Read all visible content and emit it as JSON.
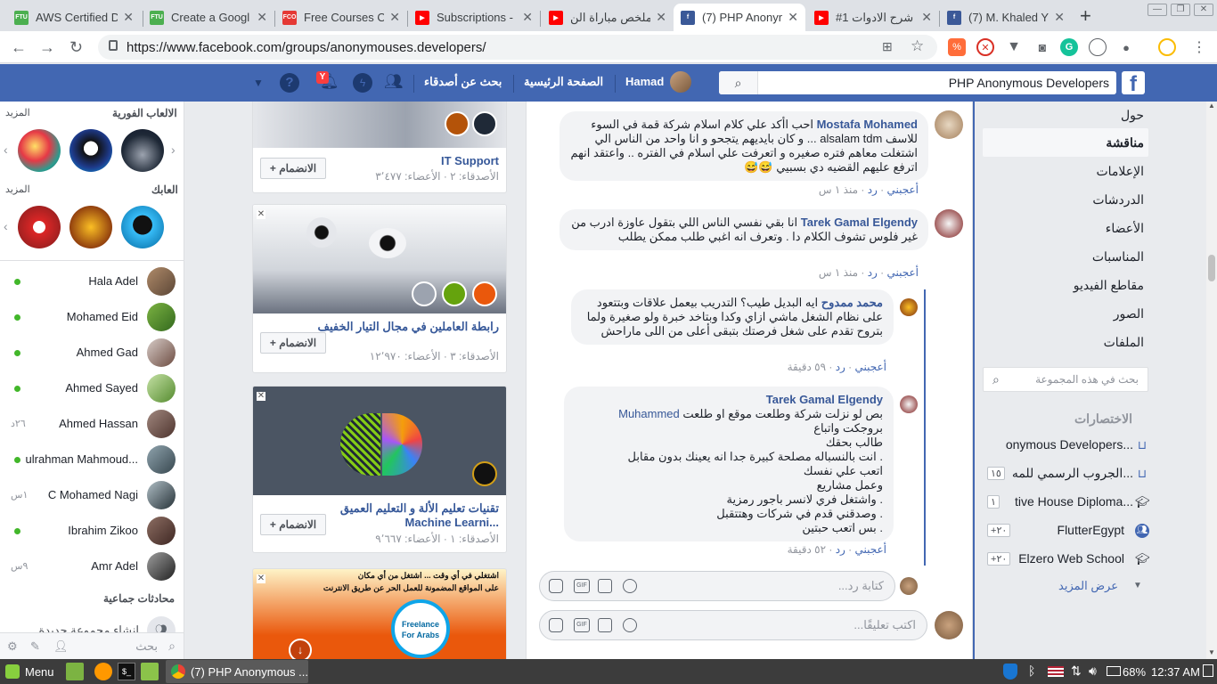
{
  "browser": {
    "tabs": [
      {
        "label": "AWS Certified D",
        "favicon": "ftu-icon",
        "color": "#4caf50"
      },
      {
        "label": "Create a Googl",
        "favicon": "ftu-icon",
        "color": "#4caf50"
      },
      {
        "label": "Free Courses O",
        "favicon": "fco-icon",
        "color": "#e53935"
      },
      {
        "label": "Subscriptions -",
        "favicon": "youtube-icon",
        "color": "#ff0000"
      },
      {
        "label": "ملخص مباراة الن",
        "favicon": "youtube-icon",
        "color": "#ff0000"
      },
      {
        "label": "(7) PHP Anonym",
        "favicon": "facebook-icon",
        "color": "#3b5998"
      },
      {
        "label": "#1 شرح الادوات",
        "favicon": "youtube-icon",
        "color": "#ff0000"
      },
      {
        "label": "(7) M. Khaled Y",
        "favicon": "facebook-icon",
        "color": "#3b5998"
      }
    ],
    "active_tab": 5,
    "url": "https://www.facebook.com/groups/anonymouses.developers/"
  },
  "fb_header": {
    "search_value": "PHP Anonymous Developers",
    "user_name": "Hamad",
    "home_label": "الصفحة الرئيسية",
    "find_friends_label": "بحث عن أصدقاء",
    "notif_count": "Y",
    "brand_color": "#4267b2"
  },
  "sidebar": {
    "instant_games_label": "الالعاب الفورية",
    "games_more": "المزيد",
    "playing_label": "العابك",
    "playing_more": "المزيد",
    "contacts": [
      {
        "name": "Hala Adel",
        "online": true,
        "time": ""
      },
      {
        "name": "Mohamed Eid",
        "online": true,
        "time": ""
      },
      {
        "name": "Ahmed Gad",
        "online": true,
        "time": ""
      },
      {
        "name": "Ahmed Sayed",
        "online": true,
        "time": ""
      },
      {
        "name": "Ahmed Hassan",
        "online": false,
        "time": "٢٦د"
      },
      {
        "name": "ulrahman Mahmoud...",
        "online": true,
        "time": ""
      },
      {
        "name": "C Mohamed Nagi",
        "online": false,
        "time": "١س"
      },
      {
        "name": "Ibrahim Zikoo",
        "online": true,
        "time": ""
      },
      {
        "name": "Amr Adel",
        "online": false,
        "time": "٩س"
      }
    ],
    "group_chats_label": "محادثات جماعية",
    "create_group_label": "إنشاء مجموعة جديدة",
    "search_placeholder": "بحث"
  },
  "group_suggestions": [
    {
      "title": "IT Support",
      "meta": "الأصدقاء: ٢ · الأعضاء: ٣٬٤٧٧",
      "join": "+ الانضمام"
    },
    {
      "title": "رابطة العاملين في مجال التيار الخفيف",
      "meta": "الأصدقاء: ٣ · الأعضاء: ١٢٬٩٧٠",
      "join": "+ الانضمام"
    },
    {
      "title": "تقنيات تعليم الألة و التعليم العميق Machine Learni...",
      "meta": "الأصدقاء: ١ · الأعضاء: ٩٬٦٦٧",
      "join": "+ الانضمام"
    },
    {
      "ad_line1": "اشتغلي في أي وقت ... اشتغل من أي مكان",
      "ad_line2": "على المواقع المضمونة للعمل الحر عن طريق الانترنت",
      "ad_badge": "Freelance For Arabs"
    }
  ],
  "comments": [
    {
      "author": "Mostafa Mohamed",
      "text": "احب اأكد علي كلام اسلام شركة قمة في السوء للاسف alsalam tdm ... و كان بايديهم يتجحو و انا واحد من الناس الي اشتغلت معاهم فتره صغيره و اتعرفت علي اسلام في الفتره .. واعتقد انهم اترفع عليهم القضيه دي بسبيي 😅😅",
      "like": "أعجبني",
      "reply": "رد",
      "time": "منذ ١ س"
    },
    {
      "author": "Tarek Gamal Elgendy",
      "text": "انا بقي نفسي الناس اللي بتقول عاوزة ادرب من غير فلوس تشوف الكلام دا . وتعرف انه اغبي طلب ممكن يطلب",
      "like": "أعجبني",
      "reply": "رد",
      "time": "منذ ١ س"
    },
    {
      "author": "محمد ممدوح",
      "text": "ايه البديل طيب؟ التدريب بيعمل علاقات وبتتعود على نظام الشغل ماشي ازاي وكدا وبتاخد خبرة ولو صغيرة ولما بتروح تقدم على شغل فرصتك بتبقى أعلى من اللى ماراحش",
      "like": "أعجبني",
      "reply": "رد",
      "time": "٥٩ دقيقة"
    },
    {
      "author": "Tarek Gamal Elgendy",
      "mention": "Muhammed",
      "lines": [
        "بص لو نزلت شركة وطلعت موقع او طلعت",
        "بروجكت واتباع",
        "طالب بحقك",
        ". انت بالنسباله مصلحة كبيرة جدا انه يعينك بدون مقابل",
        "اتعب علي نفسك",
        "وعمل مشاريع",
        ". واشتغل فري لانسر باجور رمزية",
        ". وصدقني قدم في شركات وهتتقبل",
        ". بس اتعب حبتين"
      ],
      "like": "أعجبني",
      "reply": "رد",
      "time": "٥٢ دقيقة"
    }
  ],
  "reply_placeholder": "كتابة رد...",
  "comment_placeholder": "اكتب تعليقًا...",
  "group_nav": {
    "items": [
      "حول",
      "مناقشة",
      "الإعلامات",
      "الدردشات",
      "الأعضاء",
      "المناسبات",
      "مقاطع الفيديو",
      "الصور",
      "الملفات"
    ],
    "active": 1,
    "search_placeholder": "بحث في هذه المجموعة"
  },
  "shortcuts": {
    "title": "الاختصارات",
    "items": [
      {
        "label": "onymous Developers...",
        "badge": "",
        "icon": "group-icon"
      },
      {
        "label": "الجروب الرسمي للمه...",
        "badge": "١٥",
        "icon": "group-icon"
      },
      {
        "label": "tive House Diploma...",
        "badge": "١",
        "icon": "graduation-cap-icon"
      },
      {
        "label": "FlutterEgypt",
        "badge": "+٢٠",
        "icon": "people-icon"
      },
      {
        "label": "Elzero Web School",
        "badge": "+٢٠",
        "icon": "graduation-cap-icon"
      }
    ],
    "show_more": "عرض المزيد"
  },
  "taskbar": {
    "menu_label": "Menu",
    "window_label": "(7) PHP Anonymous ...",
    "battery": "68%",
    "clock": "12:37 AM"
  }
}
